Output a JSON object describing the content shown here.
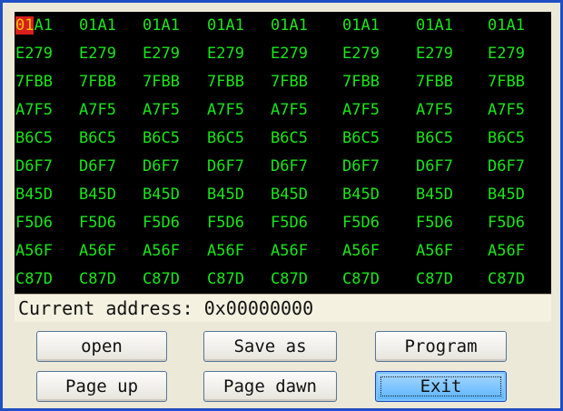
{
  "memory_grid": {
    "rows": [
      [
        "01A1",
        "01A1",
        "01A1",
        "01A1",
        "01A1",
        "01A1",
        "01A1",
        "01A1"
      ],
      [
        "E279",
        "E279",
        "E279",
        "E279",
        "E279",
        "E279",
        "E279",
        "E279"
      ],
      [
        "7FBB",
        "7FBB",
        "7FBB",
        "7FBB",
        "7FBB",
        "7FBB",
        "7FBB",
        "7FBB"
      ],
      [
        "A7F5",
        "A7F5",
        "A7F5",
        "A7F5",
        "A7F5",
        "A7F5",
        "A7F5",
        "A7F5"
      ],
      [
        "B6C5",
        "B6C5",
        "B6C5",
        "B6C5",
        "B6C5",
        "B6C5",
        "B6C5",
        "B6C5"
      ],
      [
        "D6F7",
        "D6F7",
        "D6F7",
        "D6F7",
        "D6F7",
        "D6F7",
        "D6F7",
        "D6F7"
      ],
      [
        "B45D",
        "B45D",
        "B45D",
        "B45D",
        "B45D",
        "B45D",
        "B45D",
        "B45D"
      ],
      [
        "F5D6",
        "F5D6",
        "F5D6",
        "F5D6",
        "F5D6",
        "F5D6",
        "F5D6",
        "F5D6"
      ],
      [
        "A56F",
        "A56F",
        "A56F",
        "A56F",
        "A56F",
        "A56F",
        "A56F",
        "A56F"
      ],
      [
        "C87D",
        "C87D",
        "C87D",
        "C87D",
        "C87D",
        "C87D",
        "C87D",
        "C87D"
      ]
    ],
    "text_color": "#19e619",
    "background_color": "#000000",
    "cursor_color": "#d81e1e",
    "cursor_row": 0,
    "cursor_col": 0,
    "cursor_chars": 2
  },
  "address": {
    "label": "Current address:",
    "value": "0x00000000"
  },
  "buttons": {
    "open": "open",
    "save_as": "Save as",
    "program": "Program",
    "page_up": "Page up",
    "page_down": "Page dawn",
    "exit": "Exit"
  },
  "colors": {
    "window_border": "#1f4fc4",
    "focused_button": "#59b4ff"
  }
}
